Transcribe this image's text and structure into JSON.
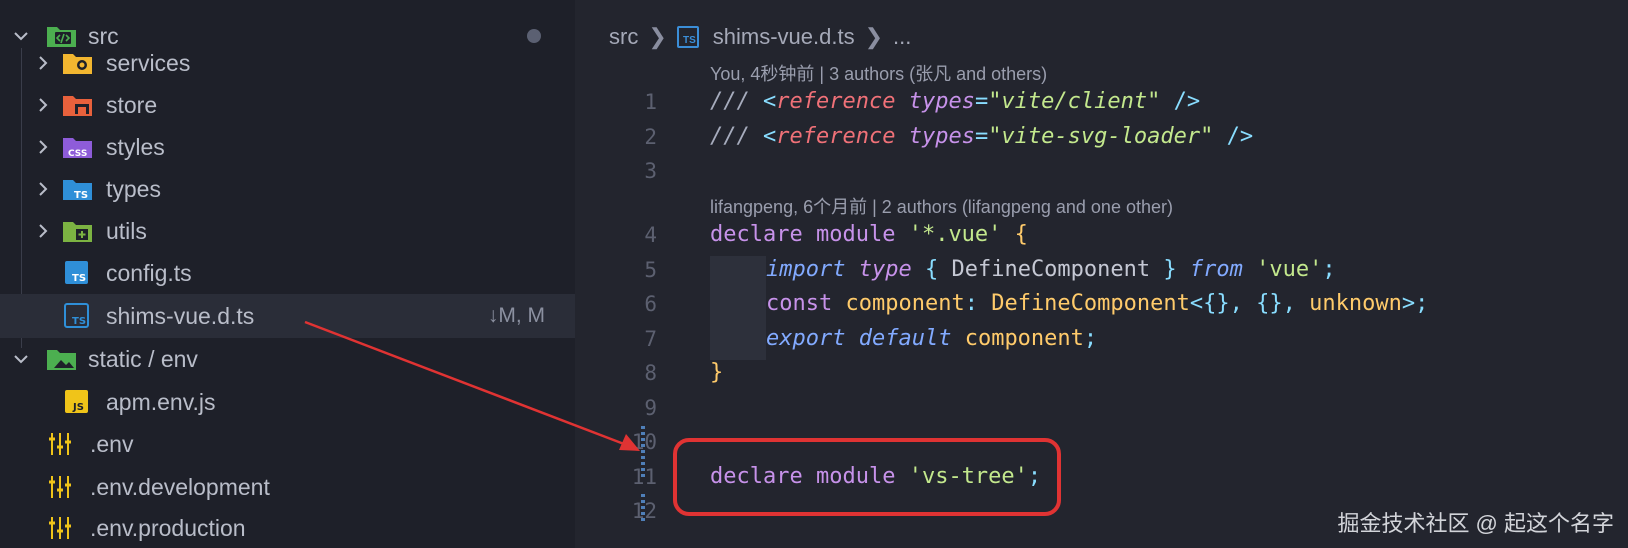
{
  "sidebar": {
    "root_folder": "src",
    "items": [
      {
        "label": "services",
        "icon": "services-folder-icon"
      },
      {
        "label": "store",
        "icon": "store-folder-icon"
      },
      {
        "label": "styles",
        "icon": "styles-folder-icon"
      },
      {
        "label": "types",
        "icon": "types-folder-icon"
      },
      {
        "label": "utils",
        "icon": "utils-folder-icon"
      },
      {
        "label": "config.ts",
        "icon": "typescript-file-icon"
      },
      {
        "label": "shims-vue.d.ts",
        "icon": "typescript-file-icon",
        "git_status": "↓M, M"
      },
      {
        "label": "static / env",
        "icon": "image-folder-icon"
      },
      {
        "label": "apm.env.js",
        "icon": "javascript-file-icon"
      },
      {
        "label": ".env",
        "icon": "env-settings-icon"
      },
      {
        "label": ".env.development",
        "icon": "env-settings-icon"
      },
      {
        "label": ".env.production",
        "icon": "env-settings-icon"
      }
    ]
  },
  "editor": {
    "breadcrumb": {
      "folder": "src",
      "file": "shims-vue.d.ts",
      "more": "..."
    },
    "blame_1": "You, 4秒钟前 | 3 authors (张凡 and others)",
    "blame_2": "lifangpeng, 6个月前 | 2 authors (lifangpeng and one other)",
    "line_numbers": [
      "1",
      "2",
      "3",
      "4",
      "5",
      "6",
      "7",
      "8",
      "9",
      "10",
      "11",
      "12"
    ]
  },
  "watermark": "掘金技术社区 @ 起这个名字",
  "colors": {
    "editor_bg": "#23252e",
    "sidebar_bg": "#1e2029",
    "highlight_border": "#e03333",
    "arrow": "#e03333",
    "ts_blue": "#3b8ed8"
  }
}
